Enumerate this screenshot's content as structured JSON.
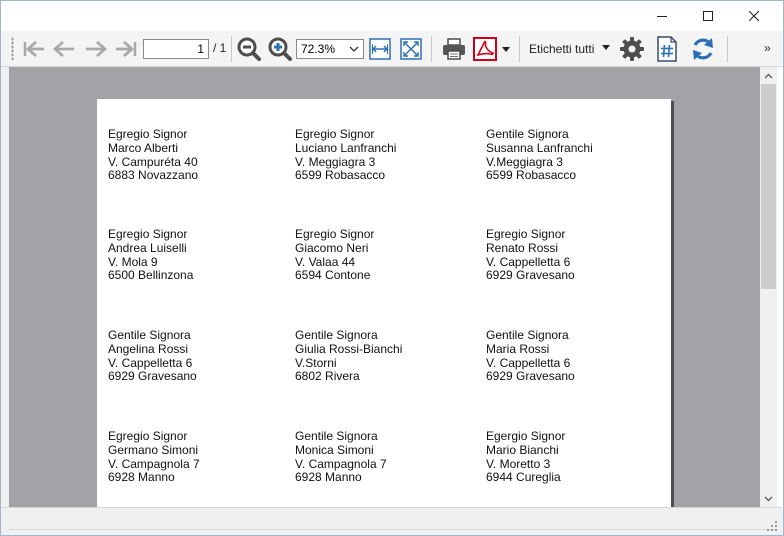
{
  "toolbar": {
    "page_current": "1",
    "page_total": "/ 1",
    "zoom_value": "72.3%",
    "labels_dropdown": "Etichetti tutti",
    "overflow_glyph": "»"
  },
  "icons": {
    "first": "first-page-icon",
    "prev": "previous-page-icon",
    "next": "next-page-icon",
    "last": "last-page-icon",
    "zoom_out": "zoom-out-icon",
    "zoom_in": "zoom-in-icon",
    "fit_width": "fit-width-icon",
    "fit_page": "fit-page-icon",
    "print": "printer-icon",
    "pdf": "pdf-icon",
    "settings": "gear-icon",
    "numbering": "hash-document-icon",
    "refresh": "refresh-icon"
  },
  "colors": {
    "accent_blue": "#2a6fb6",
    "pdf_red": "#d0021b",
    "zoom_grey": "#4d4d4d",
    "doc_background": "#a3a3a7"
  },
  "labels": [
    [
      "Egregio Signor",
      "Marco Alberti",
      "V. Campuréta 40",
      "6883 Novazzano"
    ],
    [
      "Egregio Signor",
      "Luciano Lanfranchi",
      "V. Meggiagra 3",
      "6599 Robasacco"
    ],
    [
      "Gentile Signora",
      "Susanna Lanfranchi",
      "V.Meggiagra 3",
      "6599 Robasacco"
    ],
    [
      "Egregio Signor",
      "Andrea Luiselli",
      "V. Mola 9",
      "6500 Bellinzona"
    ],
    [
      "Egregio Signor",
      "Giacomo Neri",
      "V. Valaa 44",
      "6594 Contone"
    ],
    [
      "Egregio Signor",
      "Renato Rossi",
      "V. Cappelletta 6",
      "6929 Gravesano"
    ],
    [
      "Gentile Signora",
      "Angelina Rossi",
      "V. Cappelletta 6",
      "6929 Gravesano"
    ],
    [
      "Gentile Signora",
      "Giulia Rossi-Bianchi",
      "V.Storni",
      "6802 Rivera"
    ],
    [
      "Gentile Signora",
      "Maria Rossi",
      "V. Cappelletta 6",
      "6929 Gravesano"
    ],
    [
      "Egregio Signor",
      "Germano Simoni",
      "V. Campagnola 7",
      "6928 Manno"
    ],
    [
      "Gentile Signora",
      "Monica Simoni",
      "V. Campagnola 7",
      "6928 Manno"
    ],
    [
      "Egergio Signor",
      "Mario Bianchi",
      "V. Moretto 3",
      "6944 Cureglia"
    ]
  ]
}
